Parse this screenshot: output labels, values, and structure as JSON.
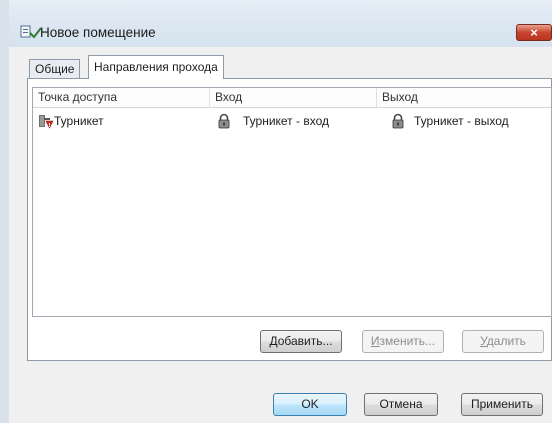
{
  "window": {
    "title": "Новое помещение",
    "close_glyph": "×"
  },
  "tabs": [
    {
      "label": "Общие",
      "active": false
    },
    {
      "label": "Направления прохода",
      "active": true
    }
  ],
  "list": {
    "columns": [
      "Точка доступа",
      "Вход",
      "Выход"
    ],
    "rows": [
      {
        "access_point": "Турникет",
        "access_point_icon": "turnstile-warning-icon",
        "entry": "Турникет - вход",
        "entry_icon": "lock-icon",
        "exit": "Турникет - выход",
        "exit_icon": "lock-icon"
      }
    ]
  },
  "panel_buttons": {
    "add_first": "Д",
    "add_rest": "обавить...",
    "edit_first": "И",
    "edit_rest": "зменить...",
    "delete_first": "У",
    "delete_rest": "далить"
  },
  "dialog_buttons": {
    "ok": "OK",
    "cancel": "Отмена",
    "apply": "Применить"
  },
  "colors": {
    "titlebar": "#dbe6f1",
    "close_button": "#c8452f",
    "default_button_border": "#3c7fb1"
  }
}
